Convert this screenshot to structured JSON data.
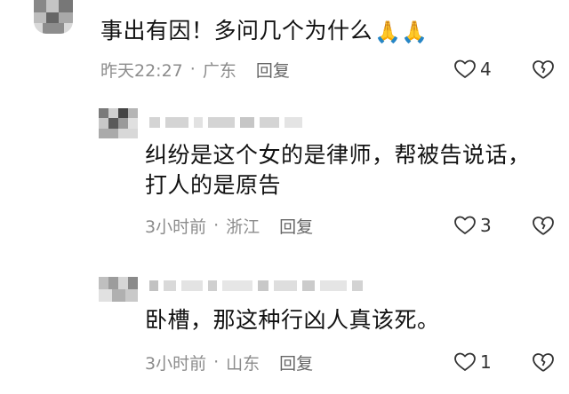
{
  "comments": [
    {
      "text": "事出有因！多问几个为什么",
      "emoji": "🙏🙏",
      "time": "昨天22:27",
      "location": "广东",
      "reply_label": "回复",
      "likes": "4"
    },
    {
      "text_line1": "纠纷是这个女的是律师，帮被告说话，",
      "text_line2": "打人的是原告",
      "time": "3小时前",
      "location": "浙江",
      "reply_label": "回复",
      "likes": "3"
    },
    {
      "text": "卧槽，那这种行凶人真该死。",
      "time": "3小时前",
      "location": "山东",
      "reply_label": "回复",
      "likes": "1"
    }
  ],
  "separator": "·",
  "colors": {
    "meta_text": "#8c8c8c",
    "body_text": "#121212",
    "icon_stroke": "#333333"
  },
  "icons": {
    "like": "heart-outline-icon",
    "dislike": "broken-heart-icon"
  }
}
